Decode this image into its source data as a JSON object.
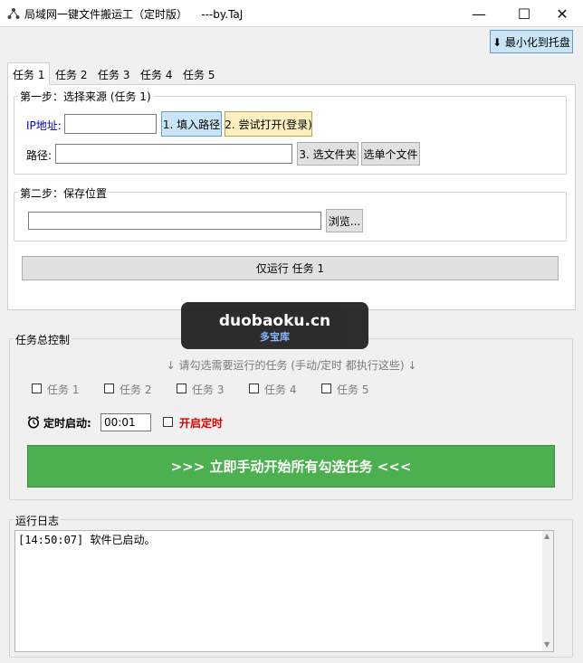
{
  "window": {
    "title": "局域网一键文件搬运工（定时版）    ---by.TaJ",
    "minimize_glyph": "—",
    "maximize_glyph": "☐",
    "close_glyph": "✕"
  },
  "toolbar": {
    "tray_button": "⬇ 最小化到托盘"
  },
  "tabs": [
    {
      "label": "任务 1",
      "active": true
    },
    {
      "label": "任务 2"
    },
    {
      "label": "任务 3"
    },
    {
      "label": "任务 4"
    },
    {
      "label": "任务 5"
    }
  ],
  "step1": {
    "title": "第一步：选择来源 (任务 1)",
    "ip_label": "IP地址:",
    "ip_value": "",
    "fill_path_button": "1. 填入路径",
    "try_open_button": "2. 尝试打开(登录)",
    "path_label": "路径:",
    "path_value": "",
    "choose_folder_button": "3. 选文件夹",
    "choose_file_button": "选单个文件"
  },
  "step2": {
    "title": "第二步：保存位置",
    "save_value": "",
    "browse_button": "浏览..."
  },
  "run_only_button": "仅运行 任务 1",
  "watermark": {
    "main": "duobaoku.cn",
    "sub": "多宝库"
  },
  "control": {
    "title": "任务总控制",
    "hint": "↓ 请勾选需要运行的任务 (手动/定时 都执行这些) ↓",
    "tasks": [
      {
        "label": "任务 1",
        "checked": false
      },
      {
        "label": "任务 2",
        "checked": false
      },
      {
        "label": "任务 3",
        "checked": false
      },
      {
        "label": "任务 4",
        "checked": false
      },
      {
        "label": "任务 5",
        "checked": false
      }
    ],
    "timer_label": "定时启动:",
    "timer_value": "00:01",
    "enable_timer_label": "开启定时",
    "run_all_button": ">>> 立即手动开始所有勾选任务 <<<"
  },
  "log": {
    "title": "运行日志",
    "lines": "[14:50:07] 软件已启动。"
  },
  "colors": {
    "accent_green": "#4caf50",
    "tray_blue": "#c9e5f7",
    "fill_path_blue": "#c9e5f7",
    "try_open_yellow": "#fdf0c0",
    "ip_label_blue": "#0000c8",
    "enable_timer_red": "#e00000"
  }
}
